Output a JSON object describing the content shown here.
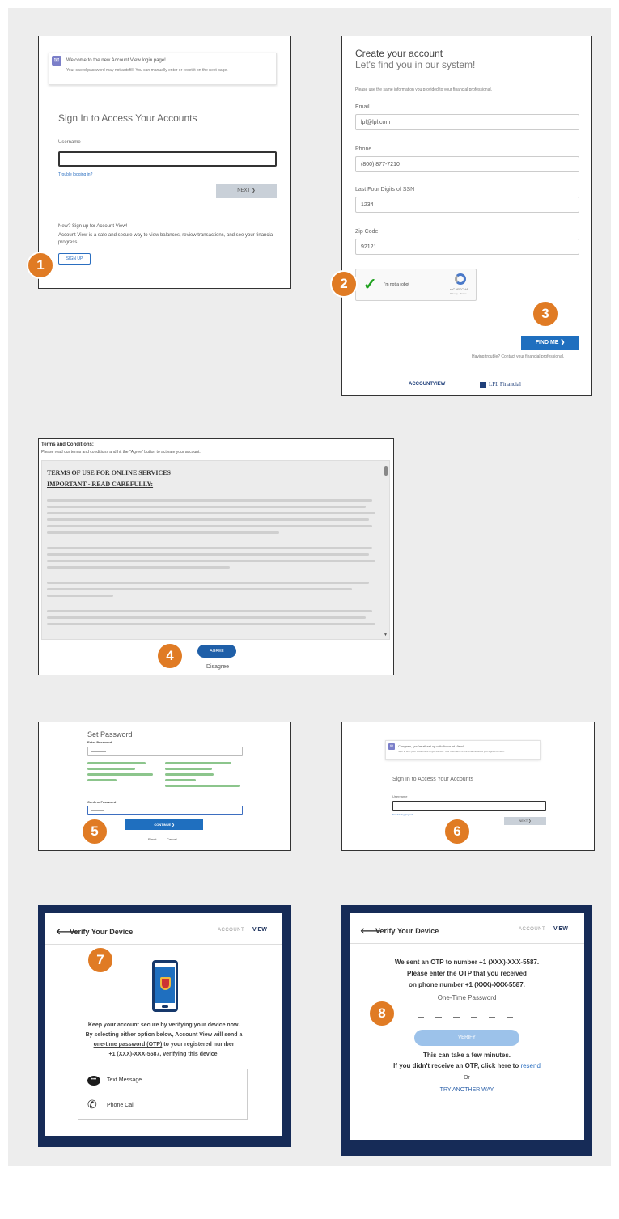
{
  "step_numbers": [
    "1",
    "2",
    "3",
    "4",
    "5",
    "6",
    "7",
    "8"
  ],
  "signin": {
    "banner_title": "Welcome to the new Account View login page!",
    "banner_text": "Your saved password may not autofill. You can manually enter or reset it on the next page.",
    "heading": "Sign In to Access Your Accounts",
    "username_label": "Username",
    "trouble_link": "Trouble logging in?",
    "next_button": "NEXT ❯",
    "new_heading": "New? Sign up for Account View!",
    "new_text": "Account View is a safe and secure way to view balances, review transactions, and see your financial progress.",
    "signup_button": "SIGN UP"
  },
  "create": {
    "title": "Create your account",
    "subtitle": "Let's find you in our system!",
    "instructions": "Please use the same information you provided to your financial professional.",
    "email_label": "Email",
    "email_value": "lpl@lpl.com",
    "phone_label": "Phone",
    "phone_value": "(800) 877-7210",
    "ssn_label": "Last Four Digits of SSN",
    "ssn_value": "1234",
    "zip_label": "Zip Code",
    "zip_value": "92121",
    "captcha_text": "I'm not a robot",
    "captcha_brand": "reCAPTCHA",
    "captcha_terms": "Privacy - Terms",
    "findme_button": "FIND ME ❯",
    "trouble_text": "Having trouble? Contact your financial professional.",
    "logo_account": "ACCOUNTVIEW",
    "logo_lpl": "LPL Financial"
  },
  "terms": {
    "title": "Terms and Conditions:",
    "instructions": "Please read our terms and conditions and hit the \"Agree\" button to activate your account.",
    "heading1": "TERMS OF USE FOR ONLINE SERVICES",
    "heading2": "IMPORTANT - READ CAREFULLY:",
    "agree_button": "AGREE",
    "disagree_link": "Disagree"
  },
  "setpwd": {
    "title": "Set Password",
    "enter_label": "Enter Password",
    "confirm_label": "Confirm Password",
    "continue_button": "CONTINUE ❯",
    "reset_link": "Reset",
    "cancel_link": "Cancel"
  },
  "signin2": {
    "banner_title": "Congrats, you're all set up with Account View!",
    "banner_text": "Sign in with your credentials to get started. Your username is the email address you signed up with.",
    "heading": "Sign In to Access Your Accounts",
    "username_label": "Username",
    "trouble_link": "Trouble logging in?",
    "next_button": "NEXT ❯"
  },
  "verify": {
    "title": "Verify Your Device",
    "brand_a": "ACCOUNT",
    "brand_b": "VIEW",
    "text1": "Keep your account secure by verifying your device now.",
    "text2": "By selecting either option below, Account View will send a",
    "text3": "one-time password (OTP)",
    "text4": " to your registered number",
    "text5": "+1 (XXX)-XXX-5587,",
    "text6": " verifying this device.",
    "option_text": "Text Message",
    "option_call": "Phone Call"
  },
  "otp": {
    "title": "Verify Your Device",
    "brand_a": "ACCOUNT",
    "brand_b": "VIEW",
    "line1": "We sent an OTP to number +1 (XXX)-XXX-5587.",
    "line2": "Please enter the OTP that you received",
    "line3": "on phone number +1 (XXX)-XXX-5587.",
    "otp_label": "One-Time Password",
    "verify_button": "VERIFY",
    "wait_text": "This can take a few minutes.",
    "resend_prefix": "If you didn't receive an OTP, click here to ",
    "resend_link": "resend",
    "or_text": "Or",
    "another_way": "TRY ANOTHER WAY"
  },
  "colors": {
    "step_badge": "#e07b24",
    "primary_button": "#1f6fbf",
    "navy_frame": "#162b57",
    "background": "#ededed"
  }
}
